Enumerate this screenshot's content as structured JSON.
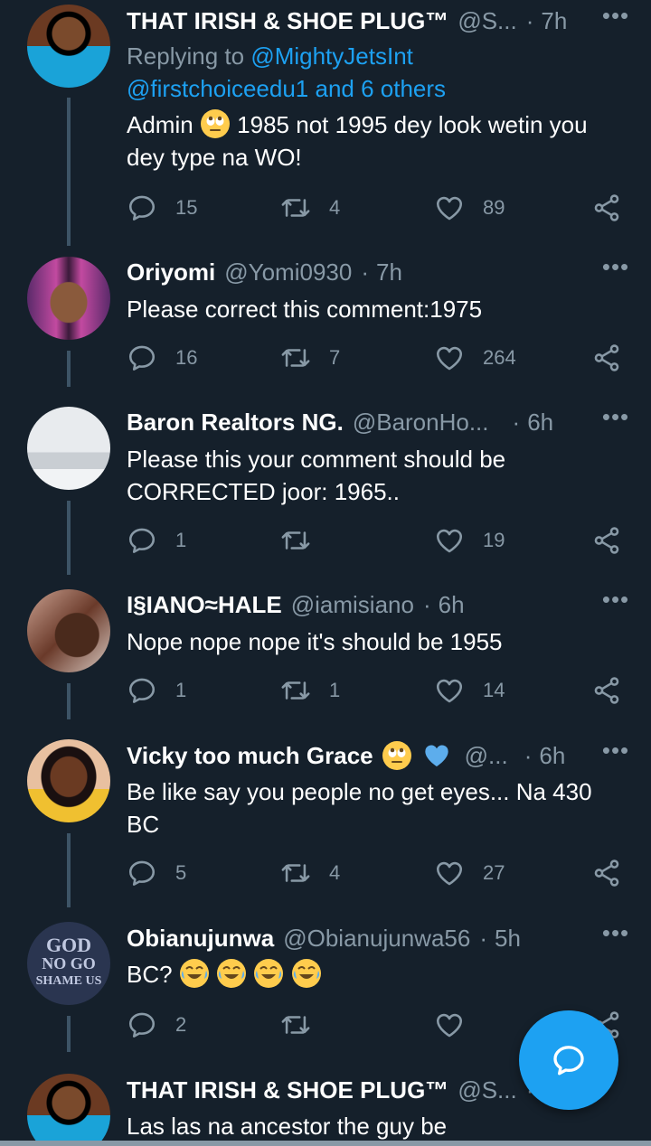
{
  "tweets": [
    {
      "name": "THAT IRISH & SHOE PLUG™",
      "handle": "@S...",
      "time": "7h",
      "replying_label": "Replying to",
      "replying_line1": "@MightyJetsInt",
      "replying_line2": "@firstchoiceedu1 and 6 others",
      "text_pre": "Admin",
      "text_post": "1985 not 1995 dey look wetin you dey type na WO!",
      "replies": "15",
      "retweets": "4",
      "likes": "89"
    },
    {
      "name": "Oriyomi",
      "handle": "@Yomi0930",
      "time": "7h",
      "text": "Please correct this comment:1975",
      "replies": "16",
      "retweets": "7",
      "likes": "264"
    },
    {
      "name": "Baron Realtors NG.",
      "handle": "@BaronHo...",
      "time": "6h",
      "text": "Please this your comment should be CORRECTED joor: 1965..",
      "replies": "1",
      "retweets": "",
      "likes": "19"
    },
    {
      "name": "I§IANO≈HALE",
      "handle": "@iamisiano",
      "time": "6h",
      "text": "Nope nope nope it's should be 1955",
      "replies": "1",
      "retweets": "1",
      "likes": "14"
    },
    {
      "name": "Vicky too much Grace",
      "handle": "@...",
      "time": "6h",
      "text": "Be like say you people no get eyes... Na 430 BC",
      "replies": "5",
      "retweets": "4",
      "likes": "27"
    },
    {
      "name": "Obianujunwa",
      "handle": "@Obianujunwa56",
      "time": "5h",
      "text": "BC?",
      "avatar_text": [
        "GOD",
        "NO GO",
        "SHAME US"
      ],
      "replies": "2",
      "retweets": "",
      "likes": ""
    },
    {
      "name": "THAT IRISH & SHOE PLUG™",
      "handle": "@S...",
      "time": "",
      "text": "Las las na ancestor the guy be"
    }
  ],
  "icons": {
    "reply": "reply-icon",
    "retweet": "retweet-icon",
    "like": "heart-icon",
    "share": "share-icon",
    "more": "more-icon",
    "compose": "compose-reply-icon",
    "emoji_eyeroll": "face-with-rolling-eyes-emoji",
    "emoji_cry": "face-with-tears-of-joy-emoji",
    "emoji_heart": "blue-heart-emoji"
  },
  "colors": {
    "background": "#15202b",
    "secondary_text": "#8899a6",
    "accent": "#1da1f2"
  }
}
